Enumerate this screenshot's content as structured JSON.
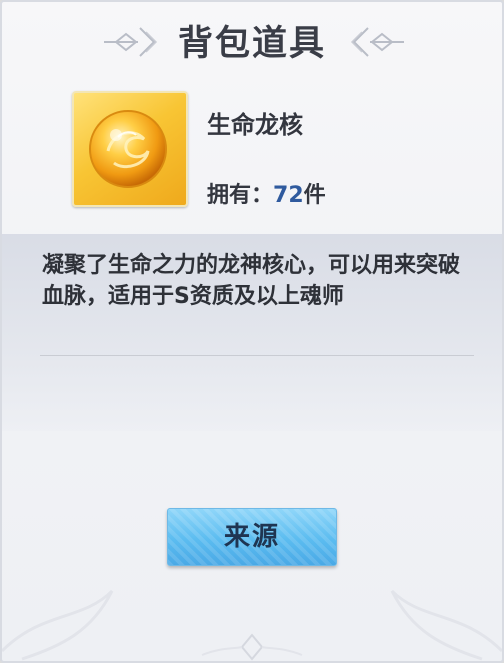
{
  "dialog": {
    "title": "背包道具"
  },
  "item": {
    "name": "生命龙核",
    "own_label": "拥有：",
    "own_count": "72",
    "own_unit": "件",
    "icon": "golden-dragon-orb-icon",
    "description": "凝聚了生命之力的龙神核心，可以用来突破血脉，适用于S资质及以上魂师"
  },
  "actions": {
    "source_label": "来源"
  },
  "colors": {
    "title_text": "#3a3d47",
    "count_text": "#2f5a9e",
    "button_fill": "#5bbcf0",
    "item_bg": "#f8c534"
  }
}
